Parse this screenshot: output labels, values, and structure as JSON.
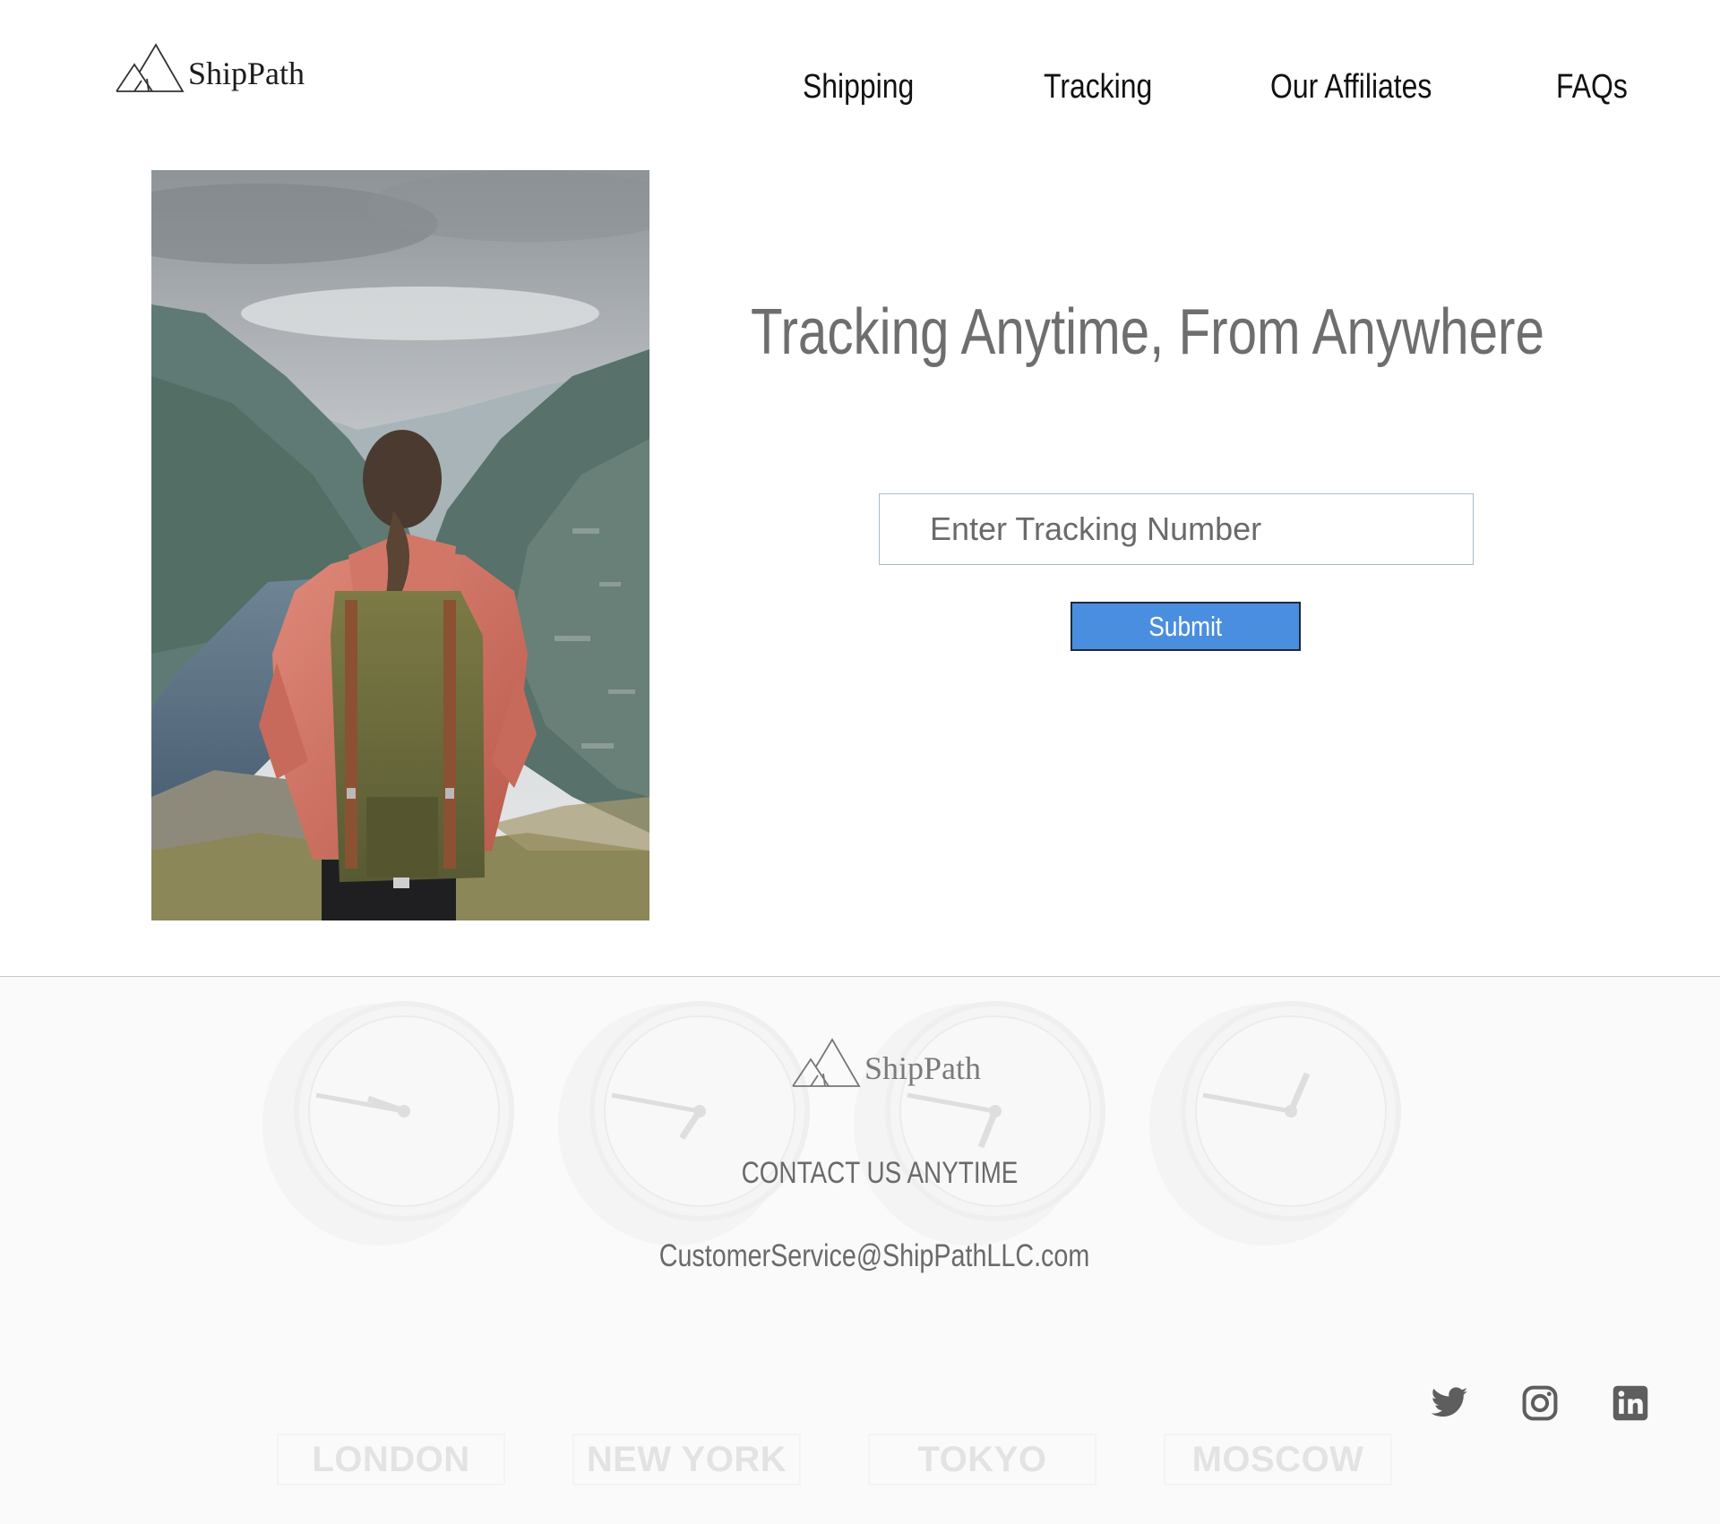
{
  "brand": {
    "name": "ShipPath"
  },
  "nav": {
    "items": [
      {
        "label": "Shipping"
      },
      {
        "label": "Tracking"
      },
      {
        "label": "Our Affiliates"
      },
      {
        "label": "FAQs"
      }
    ]
  },
  "hero": {
    "title": "Tracking Anytime, From Anywhere",
    "tracking_placeholder": "Enter Tracking Number",
    "tracking_value": "",
    "submit_label": "Submit",
    "photo": "hiker-with-backpack-overlooking-mountain-lake"
  },
  "footer": {
    "contact_heading": "CONTACT US ANYTIME",
    "email": "CustomerService@ShipPathLLC.com",
    "clocks": [
      {
        "city": "LONDON"
      },
      {
        "city": "NEW YORK"
      },
      {
        "city": "TOKYO"
      },
      {
        "city": "MOSCOW"
      }
    ],
    "social": [
      {
        "icon": "twitter-icon"
      },
      {
        "icon": "instagram-icon"
      },
      {
        "icon": "linkedin-icon"
      }
    ]
  },
  "colors": {
    "accent": "#4a8ee0",
    "title_gray": "#6e6e6e",
    "footer_bg": "#fafafa"
  }
}
